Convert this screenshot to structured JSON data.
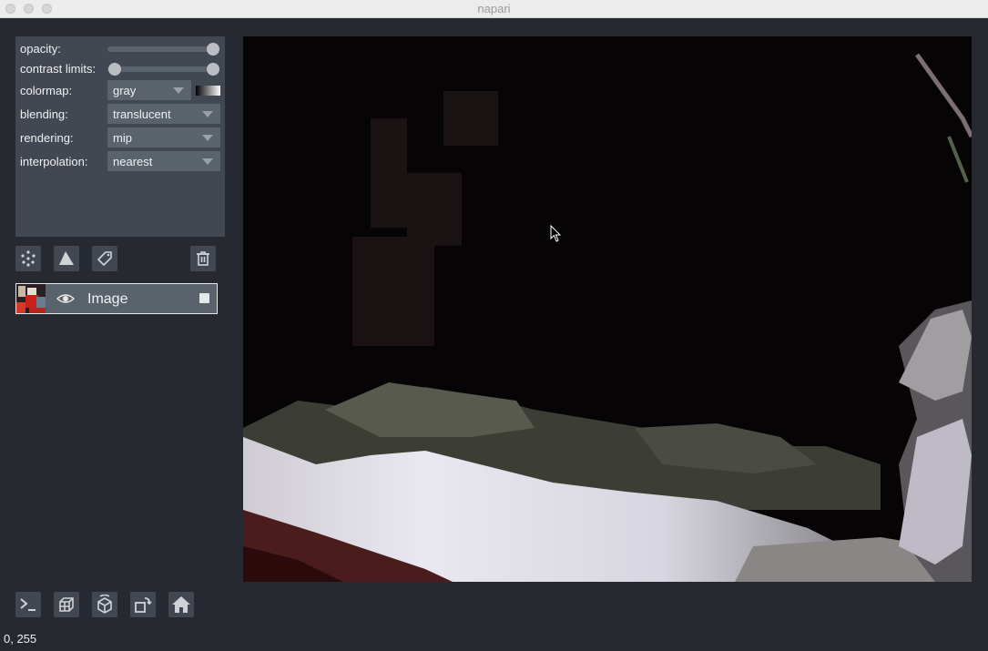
{
  "window": {
    "title": "napari"
  },
  "controls": {
    "opacity": {
      "label": "opacity:",
      "value": 1.0
    },
    "contrast_limits": {
      "label": "contrast limits:",
      "min": 0.0,
      "max": 1.0
    },
    "colormap": {
      "label": "colormap:",
      "value": "gray"
    },
    "blending": {
      "label": "blending:",
      "value": "translucent"
    },
    "rendering": {
      "label": "rendering:",
      "value": "mip"
    },
    "interpolation": {
      "label": "interpolation:",
      "value": "nearest"
    }
  },
  "layer_buttons": [
    {
      "icon": "new-points-icon"
    },
    {
      "icon": "new-shapes-icon"
    },
    {
      "icon": "new-labels-icon"
    },
    {
      "icon": "delete-layer-icon"
    }
  ],
  "layers": [
    {
      "name": "Image",
      "visible": true,
      "selected": true
    }
  ],
  "viewer_buttons": [
    {
      "icon": "console-icon"
    },
    {
      "icon": "ndisplay-icon"
    },
    {
      "icon": "roll-dims-icon"
    },
    {
      "icon": "transpose-icon"
    },
    {
      "icon": "home-icon"
    }
  ],
  "status": {
    "text": "0, 255"
  },
  "colors": {
    "background": "#262930",
    "panel": "#414851",
    "widget": "#5a626c",
    "text": "#f0f1f2"
  }
}
